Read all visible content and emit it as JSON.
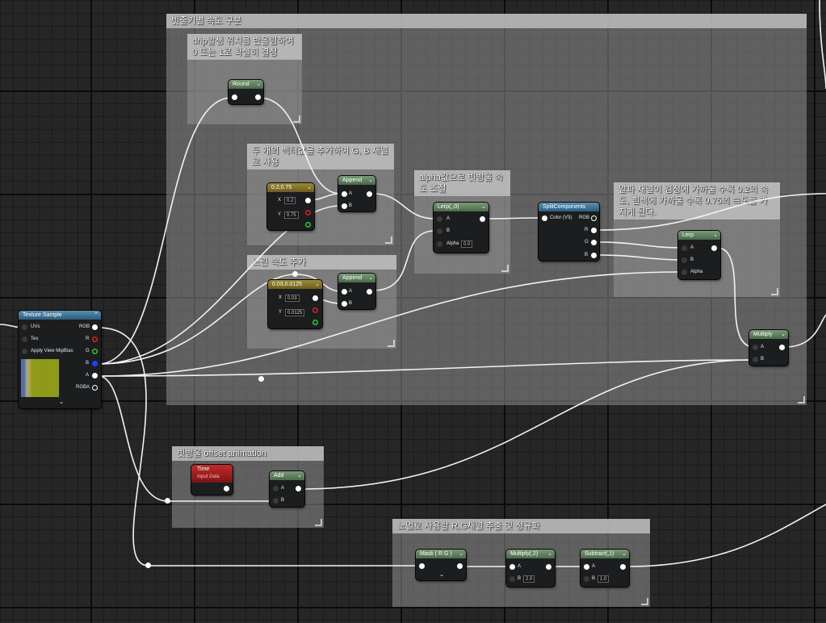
{
  "comments": {
    "main": "빗줄기별 속도 구분",
    "drip": "drip발생 위치를 반올림하여 0 또는 1로 확실히 결정",
    "vec": "두 개의 벡터값을 추가하여 G, B 채널로 사용",
    "alpha": "alpha값으로 빗방울 속도 조절",
    "depth": "알파 채널이 검정에 가까울 수록 0.2의 속도, 흰색에 가까울 수록 0.75의 속도를 가지게 된다.",
    "slow": "느린 속도 추가",
    "offset": "빗방울 offset animation",
    "normal": "노멀로 사용할 R,G채널 추출 및 정규화"
  },
  "nodes": {
    "round": {
      "title": "Round"
    },
    "const1": {
      "title": "0.2,0.75",
      "x": "0.2",
      "y": "0.75"
    },
    "append1": {
      "title": "Append",
      "a": "A",
      "b": "B"
    },
    "lerp1": {
      "title": "Lerp(,,0)",
      "a": "A",
      "b": "B",
      "alpha": "Alpha",
      "alpha_val": "0.0"
    },
    "split": {
      "title": "SplitComponents",
      "in": "Color (V3)",
      "rgb": "RGB",
      "r": "R",
      "g": "G",
      "b": "B"
    },
    "lerp2": {
      "title": "Lerp",
      "a": "A",
      "b": "B",
      "alpha": "Alpha"
    },
    "const2": {
      "title": "0.03,0.0125",
      "x": "0.03",
      "y": "0.0125"
    },
    "append2": {
      "title": "Append",
      "a": "A",
      "b": "B"
    },
    "multiply1": {
      "title": "Multiply",
      "a": "A",
      "b": "B"
    },
    "texture": {
      "title": "Texture Sample",
      "uvs": "UVs",
      "tex": "Tex",
      "mip": "Apply View MipBias",
      "rgb": "RGB",
      "r": "R",
      "g": "G",
      "b": "B",
      "a": "A",
      "rgba": "RGBA"
    },
    "time": {
      "title": "Time",
      "subtitle": "Input Data"
    },
    "add": {
      "title": "Add",
      "a": "A",
      "b": "B"
    },
    "mask": {
      "title": "Mask ( R G )"
    },
    "multiply2": {
      "title": "Multiply(,2)",
      "a": "A",
      "b": "B",
      "b_val": "2.0"
    },
    "subtract": {
      "title": "Subtract(,1)",
      "a": "A",
      "b": "B",
      "b_val": "1.0"
    }
  },
  "icons": {
    "collapse": "chevron-down-icon",
    "xlabel": "X",
    "ylabel": "Y"
  },
  "colors": {
    "comment_bg": "#969696",
    "header_green": "#5f7f5d",
    "header_yellow": "#8a7a2a",
    "header_blue": "#3a7399",
    "header_red": "#a01e1e",
    "pin_r": "#e02020",
    "pin_g": "#2ad02a",
    "pin_b": "#2040ff"
  }
}
